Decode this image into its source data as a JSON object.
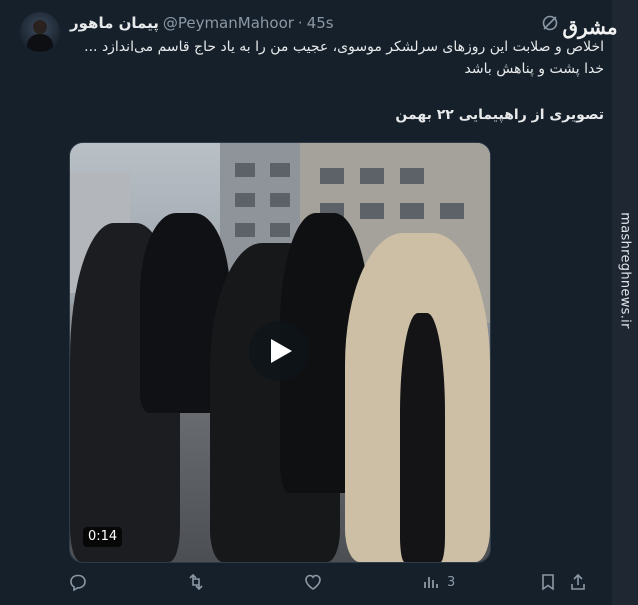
{
  "tweet": {
    "display_name": "پیمان ماهور",
    "handle": "@PeymanMahoor",
    "separator": "·",
    "time": "45s",
    "text_lines": [
      "اخلاص و صلابت این روزهای سرلشکر موسوی، عجیب من را به یاد حاج قاسم می‌اندازد ...",
      "خدا پشت و پناهش باشد"
    ],
    "text_line_last": "تصویری از راهپیمایی ۲۲ بهمن",
    "video": {
      "duration": "0:14"
    },
    "actions": {
      "views_count": "3"
    }
  },
  "watermark": {
    "logo_text": "مشرق",
    "site": "mashreghnews.ir"
  },
  "colors": {
    "background": "#15202b",
    "text": "#e7e9ea",
    "muted": "#8b98a5"
  },
  "icons": [
    "avatar",
    "grok-icon",
    "play-icon",
    "reply-icon",
    "retweet-icon",
    "like-icon",
    "views-icon",
    "bookmark-icon",
    "share-icon"
  ]
}
